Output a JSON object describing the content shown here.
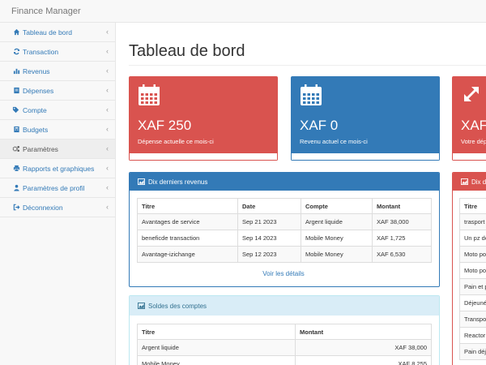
{
  "app": {
    "brand": "Finance Manager"
  },
  "sidebar": {
    "items": [
      {
        "label": "Tableau de bord",
        "icon": "home-icon"
      },
      {
        "label": "Transaction",
        "icon": "refresh-icon"
      },
      {
        "label": "Revenus",
        "icon": "bar-chart-icon"
      },
      {
        "label": "Dépenses",
        "icon": "document-icon"
      },
      {
        "label": "Compte",
        "icon": "tags-icon"
      },
      {
        "label": "Budgets",
        "icon": "calculator-icon"
      },
      {
        "label": "Paramètres",
        "icon": "cogs-icon",
        "active": true
      },
      {
        "label": "Rapports et graphiques",
        "icon": "print-icon"
      },
      {
        "label": "Paramètres de profil",
        "icon": "user-icon"
      },
      {
        "label": "Déconnexion",
        "icon": "sign-out-icon"
      }
    ]
  },
  "page": {
    "title": "Tableau de bord"
  },
  "stats": [
    {
      "value": "XAF 250",
      "caption": "Dépense actuelle ce mois-ci",
      "color": "#d9534f",
      "icon": "calendar-icon"
    },
    {
      "value": "XAF 0",
      "caption": "Revenu actuel ce mois-ci",
      "color": "#337ab7",
      "icon": "calendar-icon"
    },
    {
      "value": "XAF",
      "caption": "Votre dépe",
      "color": "#d9534f",
      "icon": "expand-icon"
    }
  ],
  "recent_income": {
    "title": "Dix derniers revenus",
    "columns": [
      "Titre",
      "Date",
      "Compte",
      "Montant"
    ],
    "rows": [
      [
        "Avantages de service",
        "Sep 21 2023",
        "Argent liquide",
        "XAF 38,000"
      ],
      [
        "beneficde transaction",
        "Sep 14 2023",
        "Mobile Money",
        "XAF 1,725"
      ],
      [
        "Avantage-izichange",
        "Sep 12 2023",
        "Mobile Money",
        "XAF 6,530"
      ]
    ],
    "link": "Voir les détails"
  },
  "balances": {
    "title": "Soldes des comptes",
    "columns": [
      "Titre",
      "Montant"
    ],
    "rows": [
      [
        "Argent liquide",
        "XAF 38,000"
      ],
      [
        "Mobile Money",
        "XAF 8,255"
      ]
    ]
  },
  "recent_expenses": {
    "title": "Dix de",
    "columns": [
      "Titre"
    ],
    "rows": [
      "trasport",
      "Un pz de",
      "Moto pou",
      "Moto pou",
      "Pain et p",
      "Déjeuné",
      "Transpor",
      "Reactor",
      "Pain déje"
    ]
  }
}
